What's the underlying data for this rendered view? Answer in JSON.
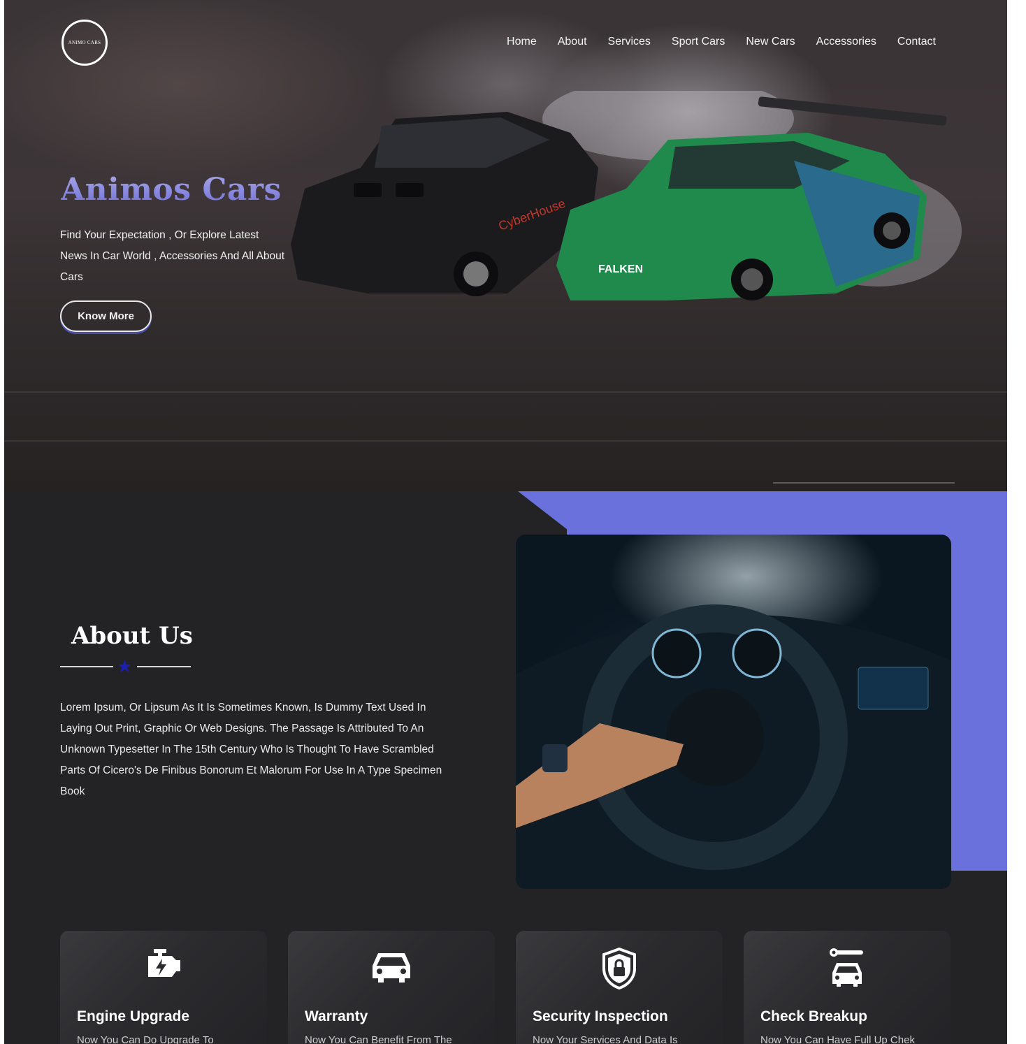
{
  "header": {
    "logo_text": "ANIMO CARS",
    "nav": [
      "Home",
      "About",
      "Services",
      "Sport Cars",
      "New Cars",
      "Accessories",
      "Contact"
    ]
  },
  "hero": {
    "title": "Animos Cars",
    "text": "Find Your Expectation , Or Explore Latest News In Car World , Accessories And All About Cars",
    "button_label": "Know More"
  },
  "about": {
    "title": "About Us",
    "text": "Lorem Ipsum, Or Lipsum As It Is Sometimes Known, Is Dummy Text Used In Laying Out Print, Graphic Or Web Designs. The Passage Is Attributed To An Unknown Typesetter In The 15th Century Who Is Thought To Have Scrambled Parts Of Cicero's De Finibus Bonorum Et Malorum For Use In A Type Specimen Book"
  },
  "services": [
    {
      "title": "Engine Upgrade",
      "text": "Now You Can Do Upgrade To",
      "icon": "engine-icon"
    },
    {
      "title": "Warranty",
      "text": "Now You Can Benefit From The",
      "icon": "car-icon"
    },
    {
      "title": "Security Inspection",
      "text": "Now Your Services And Data Is",
      "icon": "shield-lock-icon"
    },
    {
      "title": "Check Breakup",
      "text": "Now You Can Have Full Up Chek",
      "icon": "car-repair-icon"
    }
  ],
  "colors": {
    "accent": "#6b71dc",
    "page_bg": "#232224",
    "star": "#1a1fb0"
  }
}
